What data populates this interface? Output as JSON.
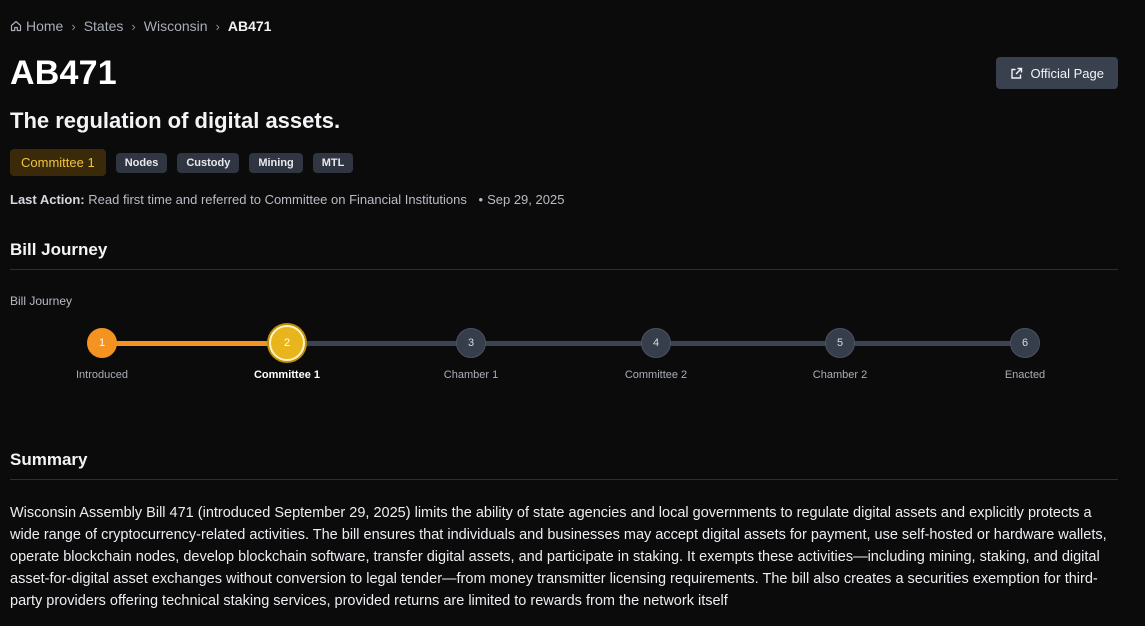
{
  "breadcrumb": {
    "home": "Home",
    "states": "States",
    "state": "Wisconsin",
    "current": "AB471"
  },
  "bill": {
    "id": "AB471",
    "title": "The regulation of digital assets.",
    "status_tag": "Committee 1",
    "tags": [
      "Nodes",
      "Custody",
      "Mining",
      "MTL"
    ]
  },
  "official_button": {
    "label": "Official Page",
    "icon": "external-link-icon"
  },
  "last_action": {
    "label": "Last Action:",
    "text": "Read first time and referred to Committee on Financial Institutions",
    "date": "Sep 29, 2025"
  },
  "journey": {
    "heading": "Bill Journey",
    "label": "Bill Journey",
    "current_step": 2,
    "steps": [
      {
        "num": "1",
        "label": "Introduced"
      },
      {
        "num": "2",
        "label": "Committee 1"
      },
      {
        "num": "3",
        "label": "Chamber 1"
      },
      {
        "num": "4",
        "label": "Committee 2"
      },
      {
        "num": "5",
        "label": "Chamber 2"
      },
      {
        "num": "6",
        "label": "Enacted"
      }
    ]
  },
  "summary": {
    "heading": "Summary",
    "text": "Wisconsin Assembly Bill 471 (introduced September 29, 2025) limits the ability of state agencies and local governments to regulate digital assets and explicitly protects a wide range of cryptocurrency-related activities. The bill ensures that individuals and businesses may accept digital assets for payment, use self-hosted or hardware wallets, operate blockchain nodes, develop blockchain software, transfer digital assets, and participate in staking. It exempts these activities—including mining, staking, and digital asset-for-digital asset exchanges without conversion to legal tender—from money transmitter licensing requirements. The bill also creates a securities exemption for third-party providers offering technical staking services, provided returns are limited to rewards from the network itself"
  },
  "colors": {
    "background": "#0b0b0c",
    "accent_orange": "#f59322",
    "accent_gold": "#e9b51c",
    "tag_bg": "#2f3541",
    "button_bg": "#39414f"
  }
}
